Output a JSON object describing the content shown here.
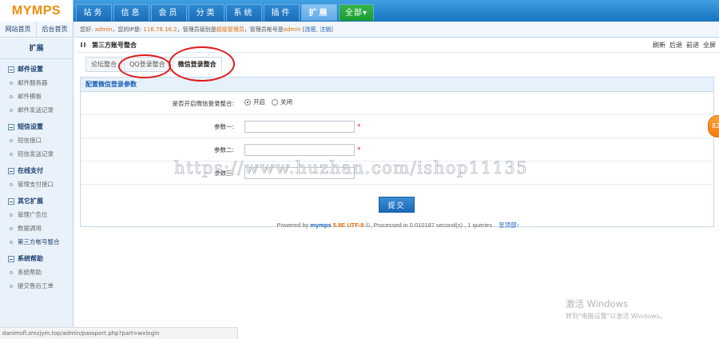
{
  "topbar": {
    "logo": "MYMPS",
    "nav": [
      {
        "label": "站务",
        "active": false
      },
      {
        "label": "信息",
        "active": false
      },
      {
        "label": "会员",
        "active": false
      },
      {
        "label": "分类",
        "active": false
      },
      {
        "label": "系统",
        "active": false
      },
      {
        "label": "插件",
        "active": false
      },
      {
        "label": "扩展",
        "active": true
      },
      {
        "label": "全部▾",
        "active": false
      }
    ]
  },
  "subbar": {
    "shortcuts": [
      "网站首页",
      "后台首页"
    ],
    "welcome_prefix": "您好: ",
    "username": "admin",
    "ip_prefix": "，您的IP是: ",
    "ip": "116.76.16.2",
    "role_prefix": "，管理员级别是",
    "role": "超级管理员",
    "account_prefix": "，管理员帐号是",
    "account": "admin",
    "links_open": " [",
    "edit_link": "改密",
    "links_sep": ", ",
    "logout_link": "注销",
    "links_close": "]"
  },
  "sidebar": {
    "title": "扩展",
    "groups": [
      {
        "title": "邮件设置",
        "items": [
          "邮件服务器",
          "邮件模板",
          "邮件发送记录"
        ]
      },
      {
        "title": "短信设置",
        "items": [
          "短信接口",
          "短信发送记录"
        ]
      },
      {
        "title": "在线支付",
        "items": [
          "管理支付接口"
        ]
      },
      {
        "title": "其它扩展",
        "items": [
          "管理广告位",
          "数据调用",
          "第三方帐号整合"
        ]
      },
      {
        "title": "系统帮助",
        "items": [
          "系统帮助",
          "提交售后工单"
        ]
      }
    ],
    "active_item": "第三方帐号整合"
  },
  "main": {
    "title": "第三方账号整合",
    "actions": [
      "刷新",
      "后退",
      "前进",
      "全屏"
    ],
    "tabs": [
      {
        "label": "论坛整合",
        "active": false
      },
      {
        "label": "QQ登录整合",
        "active": false
      },
      {
        "label": "微信登录整合",
        "active": true
      }
    ],
    "panel_title": "配置微信登录参数",
    "form": {
      "enable_label": "是否开启微信登录整合:",
      "enable_on": "开启",
      "enable_off": "关闭",
      "enable_value": "开启",
      "param1_label": "参数一:",
      "param1_value": "",
      "param2_label": "参数二:",
      "param2_value": "",
      "param3_label": "参数三:",
      "param3_value": "",
      "required_mark": "*",
      "submit_label": "提交"
    },
    "powered": {
      "prefix": "Powered by ",
      "brand": "mymps",
      "version": " 5.8E UTF-8",
      "suffix": " ©, Processed in 0.010187 second(s) , 1 queries",
      "top_link": "至顶部↑"
    }
  },
  "overlays": {
    "watermark": "https://www.huzhan.com/ishop11135",
    "activate_title": "激活 Windows",
    "activate_sub": "转到\"电脑设置\"以激活 Windows。",
    "float_badge": "82",
    "status_url": "danimsfl.zmzjym.top/admin/passport.php?part=wxlogin"
  },
  "colors": {
    "top_bar": "#1774c2",
    "logo": "#f08d0c",
    "accent": "#1a5fb4",
    "highlight": "#e36c09",
    "annotation_ring": "#e01b1b"
  }
}
